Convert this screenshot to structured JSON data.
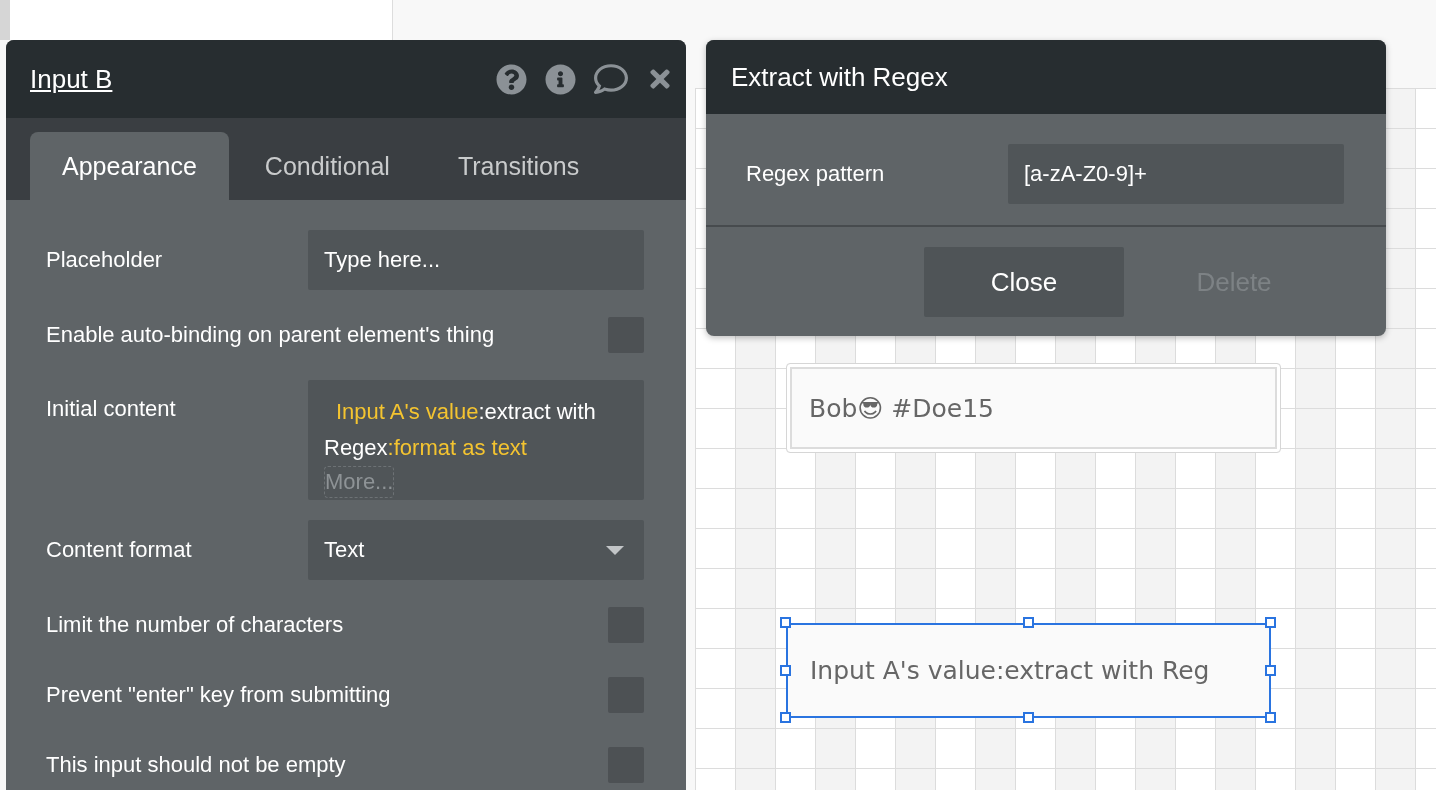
{
  "property_editor": {
    "title": "Input B",
    "tabs": [
      {
        "label": "Appearance",
        "selected": true
      },
      {
        "label": "Conditional",
        "selected": false
      },
      {
        "label": "Transitions",
        "selected": false
      }
    ],
    "rows": [
      {
        "kind": "text_input",
        "label": "Placeholder",
        "value": "Type here..."
      },
      {
        "kind": "checkbox",
        "label": "Enable auto-binding on parent element's thing",
        "checked": false
      },
      {
        "kind": "expression",
        "label": "Initial content",
        "segments": [
          {
            "kind": "dynamic",
            "text": "Input A's value"
          },
          {
            "kind": "plain",
            "text": ":extract with Regex"
          },
          {
            "kind": "dynamic",
            "text": ":format as text"
          }
        ],
        "more": "More..."
      },
      {
        "kind": "dropdown",
        "label": "Content format",
        "value": "Text"
      },
      {
        "kind": "checkbox",
        "label": "Limit the number of characters",
        "checked": false
      },
      {
        "kind": "checkbox",
        "label": "Prevent \"enter\" key from submitting",
        "checked": false
      },
      {
        "kind": "checkbox",
        "label": "This input should not be empty",
        "checked": false
      }
    ]
  },
  "regex_dialog": {
    "title": "Extract with Regex",
    "fields": [
      {
        "label": "Regex pattern",
        "value": "[a-zA-Z0-9]+"
      }
    ],
    "buttons": [
      {
        "label": "Close",
        "disabled": false
      },
      {
        "label": "Delete",
        "disabled": true
      }
    ]
  },
  "canvas": {
    "elements": [
      {
        "kind": "input",
        "value": "Bob😎 #Doe15",
        "selected": false
      },
      {
        "kind": "input",
        "value": "Input A's value:extract with Reg",
        "selected": true
      }
    ]
  }
}
